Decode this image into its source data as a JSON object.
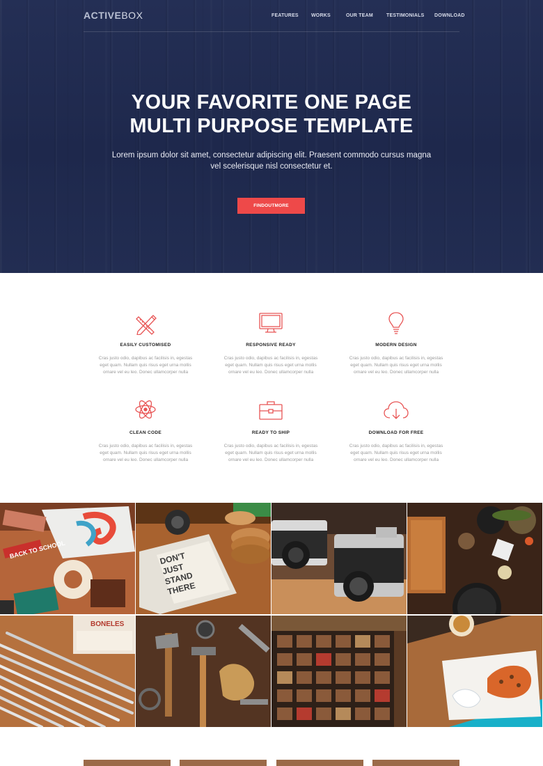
{
  "header": {
    "logo_bold": "ACTIVE",
    "logo_light": "BOX",
    "nav": [
      "FEATURES",
      "WORKS",
      "OUR TEAM",
      "TESTIMONIALS",
      "DOWNLOAD"
    ]
  },
  "hero": {
    "title_line1": "YOUR FAVORITE ONE PAGE",
    "title_line2": "MULTI PURPOSE TEMPLATE",
    "subtitle_line1": "Lorem ipsum dolor sit amet, consectetur adipiscing elit. Praesent commodo cursus magna",
    "subtitle_line2": "vel scelerisque nisl consectetur et.",
    "cta_label": "FINDOUTMORE"
  },
  "features": [
    {
      "title": "EASILY CUSTOMISED",
      "icon": "pencil-ruler-icon",
      "desc": "Cras justo odio, dapibus ac facilisis in, egestas eget quam. Nullam quis risus eget urna mollis ornare vel eu leo. Donec ullamcorper nulla"
    },
    {
      "title": "RESPONSIVE READY",
      "icon": "monitor-icon",
      "desc": "Cras justo odio, dapibus ac facilisis in, egestas eget quam. Nullam quis risus eget urna mollis ornare vel eu leo. Donec ullamcorper nulla"
    },
    {
      "title": "MODERN DESIGN",
      "icon": "lightbulb-icon",
      "desc": "Cras justo odio, dapibus ac facilisis in, egestas eget quam. Nullam quis risus eget urna mollis ornare vel eu leo. Donec ullamcorper nulla"
    },
    {
      "title": "CLEAN CODE",
      "icon": "atom-icon",
      "desc": "Cras justo odio, dapibus ac facilisis in, egestas eget quam. Nullam quis risus eget urna mollis ornare vel eu leo. Donec ullamcorper nulla"
    },
    {
      "title": "READY TO SHIP",
      "icon": "briefcase-icon",
      "desc": "Cras justo odio, dapibus ac facilisis in, egestas eget quam. Nullam quis risus eget urna mollis ornare vel eu leo. Donec ullamcorper nulla"
    },
    {
      "title": "DOWNLOAD FOR FREE",
      "icon": "cloud-download-icon",
      "desc": "Cras justo odio, dapibus ac facilisis in, egestas eget quam. Nullam quis risus eget urna mollis ornare vel eu leo. Donec ullamcorper nulla"
    }
  ],
  "gallery": {
    "images": [
      "branding-mockup-photo",
      "notebook-photo",
      "cameras-photo",
      "kitchen-tools-photo",
      "pencils-photo",
      "hand-tools-photo",
      "letterpress-type-photo",
      "food-plate-photo"
    ],
    "image_text": {
      "notebook": "DON'T JUST STAND THERE",
      "pencils_sign": "BONELES",
      "branding_sign": "BACK TO SCHOOL"
    }
  },
  "colors": {
    "hero_bg": "#1f2a4f",
    "accent": "#ee4949",
    "icon_stroke": "#e85454"
  }
}
